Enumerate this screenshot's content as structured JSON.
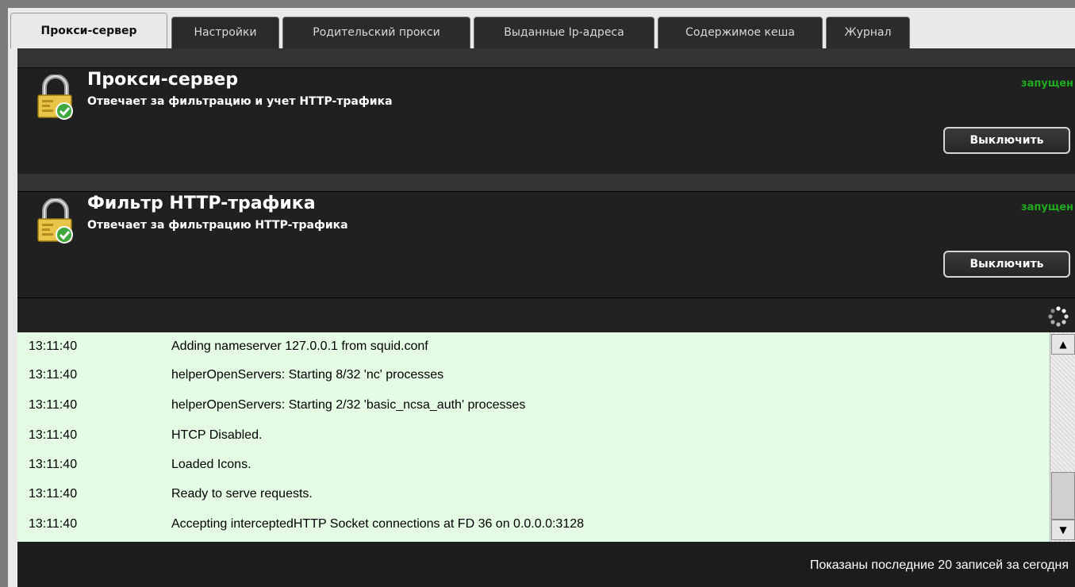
{
  "tabs": [
    {
      "label": "Прокси-сервер",
      "active": true
    },
    {
      "label": "Настройки",
      "active": false
    },
    {
      "label": "Родительский прокси",
      "active": false
    },
    {
      "label": "Выданные Ip-адреса",
      "active": false
    },
    {
      "label": "Содержимое кеша",
      "active": false
    },
    {
      "label": "Журнал",
      "active": false
    }
  ],
  "services": [
    {
      "title": "Прокси-сервер",
      "description": "Отвечает за фильтрацию и учет HTTP-трафика",
      "status": "запущен",
      "button": "Выключить",
      "icon": "lock-check-icon"
    },
    {
      "title": "Фильтр HTTP-трафика",
      "description": "Отвечает за фильтрацию HTTP-трафика",
      "status": "запущен",
      "button": "Выключить",
      "icon": "lock-check-icon"
    }
  ],
  "log": {
    "refresh_icon": "refresh-icon",
    "rows": [
      {
        "time": "13:11:40",
        "message": "Adding nameserver 127.0.0.1 from squid.conf"
      },
      {
        "time": "13:11:40",
        "message": "helperOpenServers: Starting 8/32 'nc' processes"
      },
      {
        "time": "13:11:40",
        "message": "helperOpenServers: Starting 2/32 'basic_ncsa_auth' processes"
      },
      {
        "time": "13:11:40",
        "message": "HTCP Disabled."
      },
      {
        "time": "13:11:40",
        "message": "Loaded Icons."
      },
      {
        "time": "13:11:40",
        "message": "Ready to serve requests."
      },
      {
        "time": "13:11:40",
        "message": "Accepting interceptedHTTP Socket connections at FD 36 on 0.0.0.0:3128"
      }
    ],
    "footer": "Показаны последние 20 записей за сегодня"
  },
  "colors": {
    "status_running": "#1faa1f",
    "log_background": "#e4fbe4",
    "panel_background": "#1c1c1c"
  }
}
